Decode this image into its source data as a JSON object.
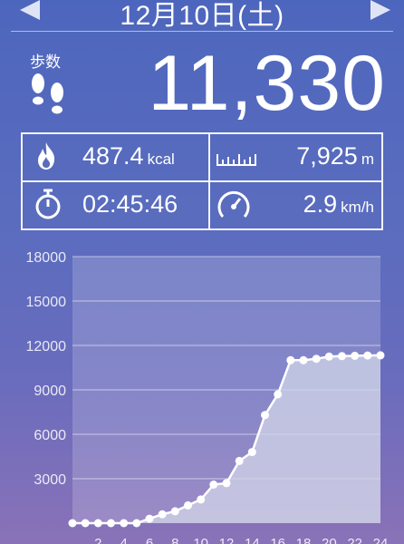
{
  "header": {
    "date": "12月10日(土)"
  },
  "summary": {
    "steps_label": "歩数",
    "steps_value": "11,330"
  },
  "stats": {
    "calories": {
      "value": "487.4",
      "unit": "kcal"
    },
    "distance": {
      "value": "7,925",
      "unit": "m"
    },
    "duration": {
      "value": "02:45:46",
      "unit": ""
    },
    "speed": {
      "value": "2.9",
      "unit": "km/h"
    }
  },
  "icons": {
    "prev": "triangle-left-icon",
    "next": "triangle-right-icon",
    "steps": "footprints-icon",
    "calories": "flame-icon",
    "distance": "ruler-icon",
    "duration": "stopwatch-icon",
    "speed": "speedometer-icon"
  },
  "colors": {
    "accent": "#ffffff",
    "plot_fill": "#c9cde3"
  },
  "chart_data": {
    "type": "area",
    "title": "",
    "xlabel": "",
    "ylabel": "",
    "ylim": [
      0,
      18000
    ],
    "xlim": [
      0,
      24
    ],
    "yticks": [
      "18000",
      "15000",
      "12000",
      "9000",
      "6000",
      "3000"
    ],
    "xticks": [
      "2",
      "4",
      "6",
      "8",
      "10",
      "12",
      "14",
      "16",
      "18",
      "20",
      "22",
      "24"
    ],
    "grid": true,
    "x": [
      0,
      1,
      2,
      3,
      4,
      5,
      6,
      7,
      8,
      9,
      10,
      11,
      12,
      13,
      14,
      15,
      16,
      17,
      18,
      19,
      20,
      21,
      22,
      23,
      24
    ],
    "values": [
      0,
      0,
      0,
      0,
      0,
      0,
      300,
      600,
      800,
      1200,
      1600,
      2600,
      2700,
      4200,
      4800,
      7300,
      8700,
      11000,
      11000,
      11100,
      11250,
      11280,
      11300,
      11320,
      11330
    ]
  }
}
